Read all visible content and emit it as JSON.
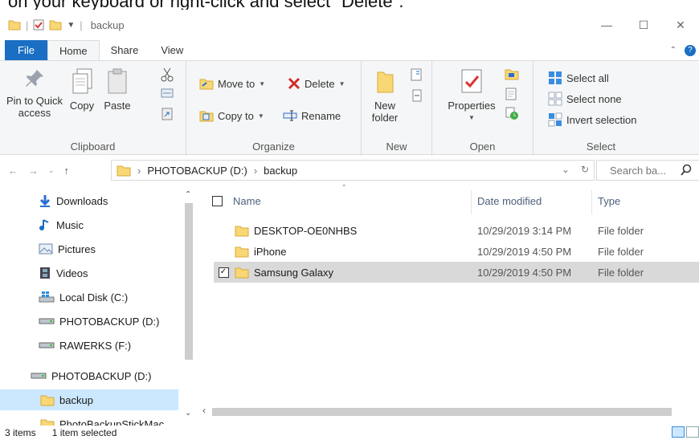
{
  "caption": "on your keyboard or right-click and select \"Delete\".",
  "window": {
    "title": "backup",
    "controls": {
      "minimize": "—",
      "maximize": "☐",
      "close": "✕"
    }
  },
  "ribbon_tabs": [
    "File",
    "Home",
    "Share",
    "View"
  ],
  "ribbon": {
    "clipboard": {
      "label": "Clipboard",
      "pin": "Pin to Quick access",
      "copy": "Copy",
      "paste": "Paste"
    },
    "organize": {
      "label": "Organize",
      "move_to": "Move to",
      "copy_to": "Copy to",
      "delete": "Delete",
      "rename": "Rename"
    },
    "new": {
      "label": "New",
      "new_folder": "New folder"
    },
    "open": {
      "label": "Open",
      "properties": "Properties"
    },
    "select": {
      "label": "Select",
      "select_all": "Select all",
      "select_none": "Select none",
      "invert": "Invert selection"
    }
  },
  "address": {
    "segments": [
      "PHOTOBACKUP (D:)",
      "backup"
    ],
    "search_placeholder": "Search ba..."
  },
  "nav_pane": {
    "items": [
      {
        "label": "Downloads",
        "icon": "download-arrow-icon"
      },
      {
        "label": "Music",
        "icon": "music-note-icon"
      },
      {
        "label": "Pictures",
        "icon": "pictures-icon"
      },
      {
        "label": "Videos",
        "icon": "film-icon"
      },
      {
        "label": "Local Disk (C:)",
        "icon": "windows-drive-icon"
      },
      {
        "label": "PHOTOBACKUP (D:)",
        "icon": "drive-icon"
      },
      {
        "label": "RAWERKS (F:)",
        "icon": "drive-icon"
      },
      {
        "label": "PHOTOBACKUP (D:)",
        "icon": "drive-icon"
      },
      {
        "label": "backup",
        "icon": "folder-icon"
      },
      {
        "label": "PhotoBackupStickMac",
        "icon": "folder-icon"
      }
    ]
  },
  "columns": {
    "name": "Name",
    "date": "Date modified",
    "type": "Type"
  },
  "files": [
    {
      "name": "DESKTOP-OE0NHBS",
      "date": "10/29/2019 3:14 PM",
      "type": "File folder",
      "checked": false
    },
    {
      "name": "iPhone",
      "date": "10/29/2019 4:50 PM",
      "type": "File folder",
      "checked": false
    },
    {
      "name": "Samsung Galaxy",
      "date": "10/29/2019 4:50 PM",
      "type": "File folder",
      "checked": true
    }
  ],
  "status": {
    "items": "3 items",
    "selected": "1 item selected"
  },
  "colors": {
    "accent": "#1a6fc4",
    "selection": "#cce8ff",
    "folder": "#f8d775"
  }
}
